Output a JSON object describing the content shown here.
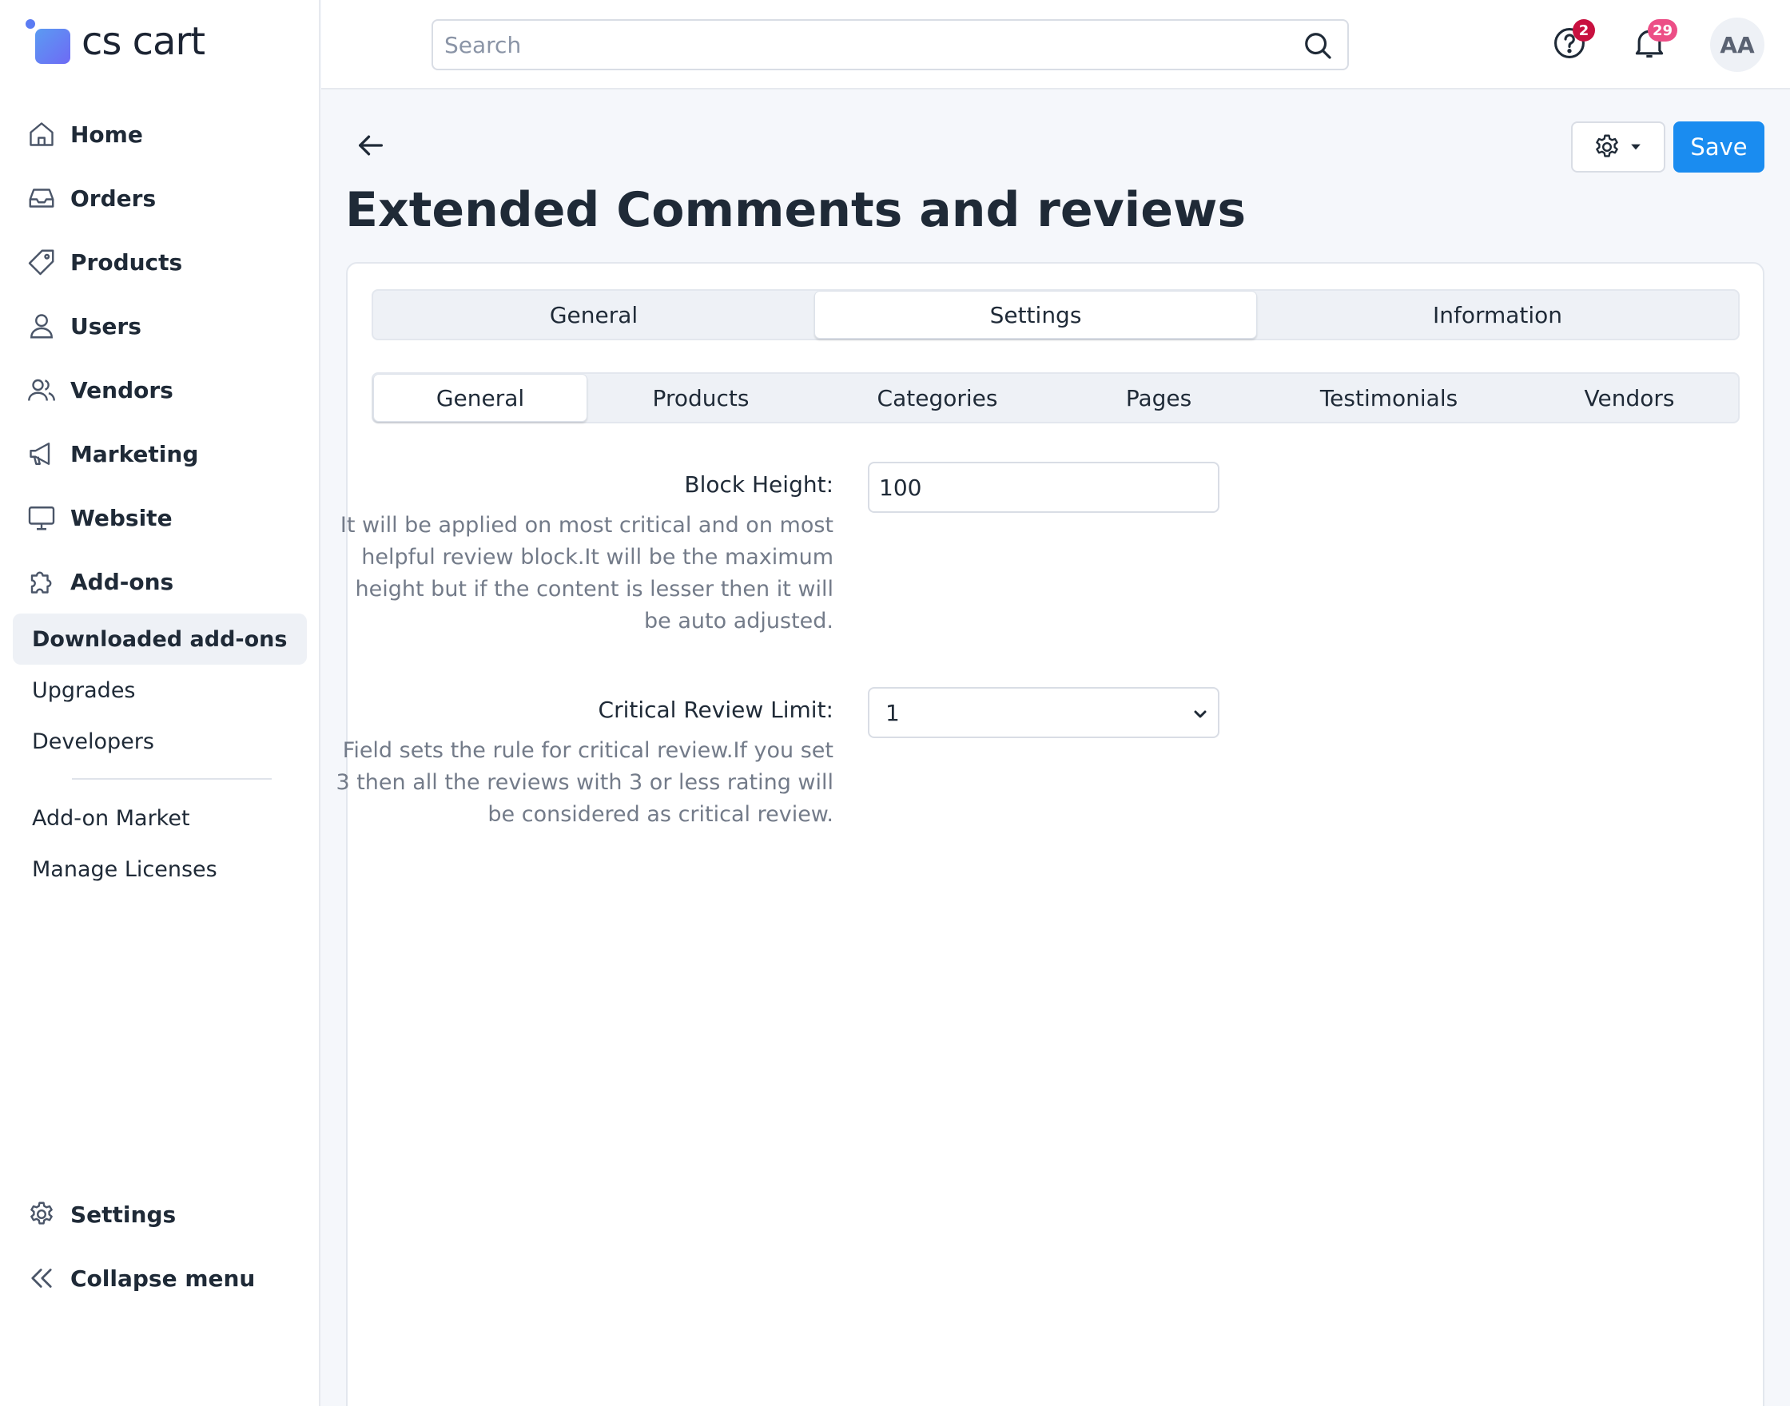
{
  "app": {
    "logo_text": "cs cart"
  },
  "search": {
    "placeholder": "Search",
    "value": ""
  },
  "header": {
    "help_badge": "2",
    "notifications_badge": "29",
    "avatar_initials": "AA",
    "help_badge_color": "#c8103f",
    "notifications_badge_color": "#ec4e86"
  },
  "sidebar": {
    "items": [
      {
        "label": "Home",
        "icon": "home-icon"
      },
      {
        "label": "Orders",
        "icon": "inbox-icon"
      },
      {
        "label": "Products",
        "icon": "tag-icon"
      },
      {
        "label": "Users",
        "icon": "user-icon"
      },
      {
        "label": "Vendors",
        "icon": "users-icon"
      },
      {
        "label": "Marketing",
        "icon": "megaphone-icon"
      },
      {
        "label": "Website",
        "icon": "monitor-icon"
      },
      {
        "label": "Add-ons",
        "icon": "puzzle-icon"
      }
    ],
    "sub_items": [
      {
        "label": "Downloaded add-ons",
        "active": true
      },
      {
        "label": "Upgrades"
      },
      {
        "label": "Developers"
      }
    ],
    "sub_items_2": [
      {
        "label": "Add-on Market"
      },
      {
        "label": "Manage Licenses"
      }
    ],
    "bottom": [
      {
        "label": "Settings",
        "icon": "gear-icon"
      },
      {
        "label": "Collapse menu",
        "icon": "double-chevron-left-icon"
      }
    ]
  },
  "page": {
    "title": "Extended Comments and reviews",
    "save_label": "Save",
    "accent_color": "#1a8cf0"
  },
  "main_tabs": [
    {
      "label": "General"
    },
    {
      "label": "Settings",
      "active": true
    },
    {
      "label": "Information"
    }
  ],
  "sub_tabs": [
    {
      "label": "General",
      "active": true
    },
    {
      "label": "Products"
    },
    {
      "label": "Categories"
    },
    {
      "label": "Pages"
    },
    {
      "label": "Testimonials"
    },
    {
      "label": "Vendors"
    }
  ],
  "fields": {
    "block_height": {
      "label": "Block Height:",
      "value": "100",
      "help": [
        "It will be applied on most critical and on most",
        "helpful review block.It will be the maximum",
        "height but if the content is lesser then it will",
        "be auto adjusted."
      ]
    },
    "critical_review_limit": {
      "label": "Critical Review Limit:",
      "selected": "1",
      "help": [
        "Field sets the rule for critical review.If you set",
        "3 then all the reviews with 3 or less rating will",
        "be considered as critical review."
      ]
    }
  }
}
